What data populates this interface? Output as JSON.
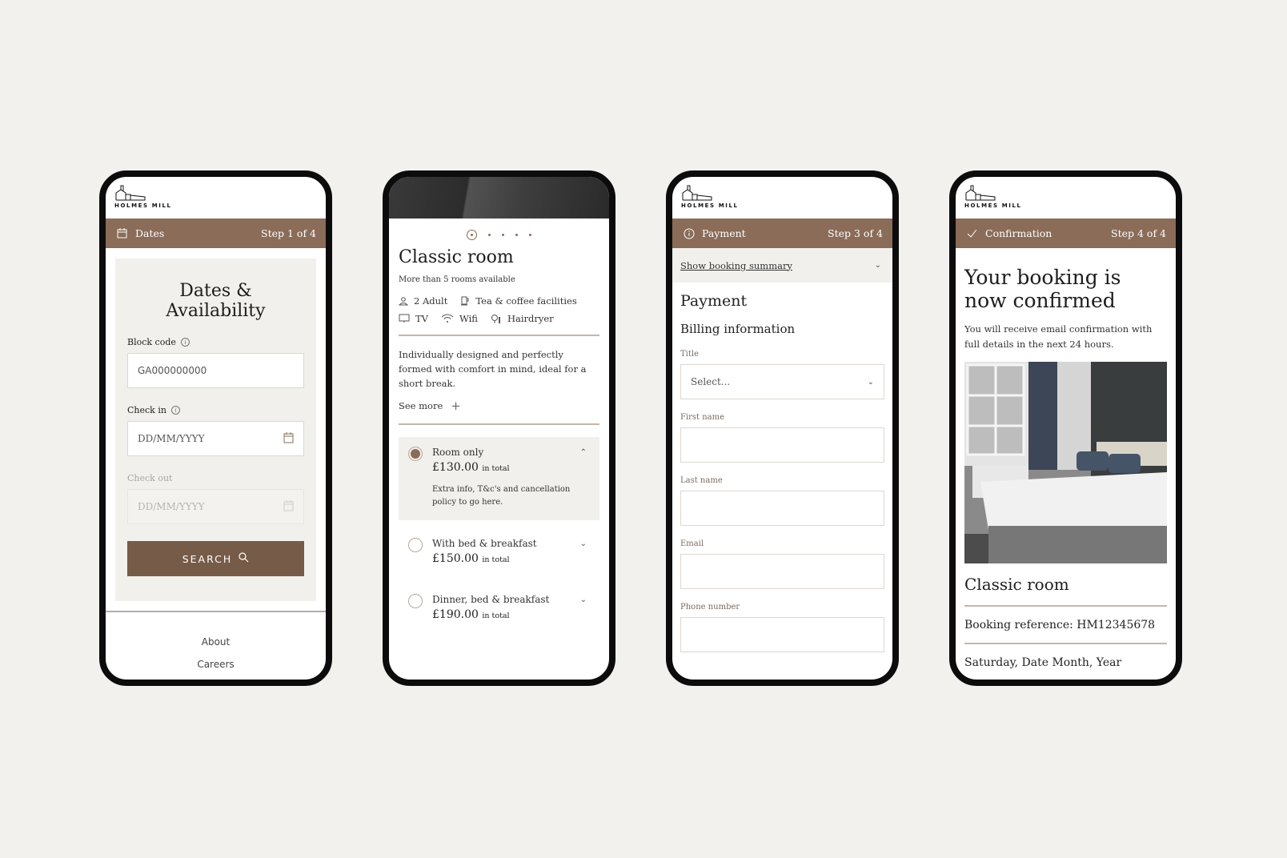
{
  "brand": {
    "name": "HOLMES MILL",
    "accent": "#8a6c58",
    "button_color": "#765b49"
  },
  "screen1": {
    "step": {
      "icon": "calendar-icon",
      "label": "Dates",
      "counter": "Step 1 of 4"
    },
    "title": "Dates & Availability",
    "block_code": {
      "label": "Block code",
      "value": "GA000000000"
    },
    "check_in": {
      "label": "Check in",
      "placeholder": "DD/MM/YYYY"
    },
    "check_out": {
      "label": "Check out",
      "placeholder": "DD/MM/YYYY"
    },
    "search_label": "SEARCH",
    "footer": [
      "About",
      "Careers"
    ]
  },
  "screen2": {
    "carousel": {
      "current": 1,
      "total": 5
    },
    "title": "Classic room",
    "availability": "More than 5 rooms available",
    "amenities": [
      {
        "icon": "person-icon",
        "label": "2 Adult"
      },
      {
        "icon": "coffee-icon",
        "label": "Tea & coffee facilities"
      },
      {
        "icon": "tv-icon",
        "label": "TV"
      },
      {
        "icon": "wifi-icon",
        "label": "Wifi"
      },
      {
        "icon": "hairdryer-icon",
        "label": "Hairdryer"
      }
    ],
    "description": "Individually designed and perfectly formed with comfort in mind, ideal for a short break.",
    "see_more": "See more",
    "rates": [
      {
        "name": "Room only",
        "price": "£130.00",
        "suffix": "in total",
        "selected": true,
        "extra": "Extra info, T&c's and cancellation policy to go here."
      },
      {
        "name": "With bed & breakfast",
        "price": "£150.00",
        "suffix": "in total",
        "selected": false
      },
      {
        "name": "Dinner, bed & breakfast",
        "price": "£190.00",
        "suffix": "in total",
        "selected": false
      }
    ]
  },
  "screen3": {
    "step": {
      "icon": "info-icon",
      "label": "Payment",
      "counter": "Step 3 of 4"
    },
    "summary_link": "Show booking summary",
    "title": "Payment",
    "subtitle": "Billing information",
    "fields": {
      "title": {
        "label": "Title",
        "placeholder": "Select..."
      },
      "first_name": {
        "label": "First name",
        "value": ""
      },
      "last_name": {
        "label": "Last name",
        "value": ""
      },
      "email": {
        "label": "Email",
        "value": ""
      },
      "phone": {
        "label": "Phone number",
        "value": ""
      }
    }
  },
  "screen4": {
    "step": {
      "icon": "check-icon",
      "label": "Confirmation",
      "counter": "Step 4 of 4"
    },
    "title_line1": "Your booking is",
    "title_line2": "now confirmed",
    "message": "You will receive email confirmation with full details in the next 24 hours.",
    "room": "Classic room",
    "booking_reference": "Booking reference: HM12345678",
    "date": "Saturday, Date Month, Year"
  }
}
